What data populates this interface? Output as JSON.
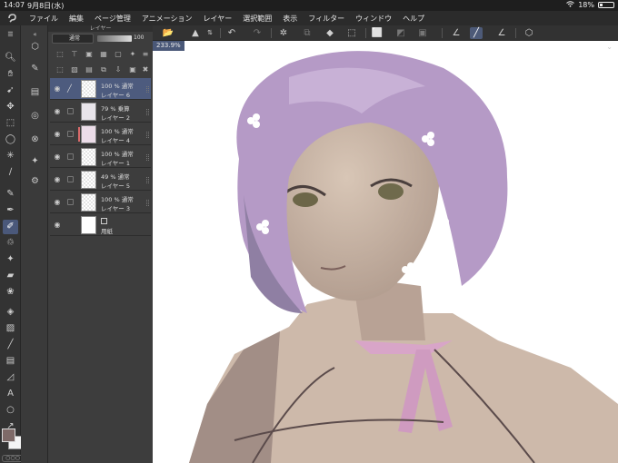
{
  "status_bar": {
    "time": "14:07",
    "date": "9月8日(水)",
    "battery_text": "18%",
    "battery_level": 0.18,
    "wifi_icon": "wifi-icon"
  },
  "menu": {
    "logo": "clip-studio-logo",
    "items": [
      "ファイル",
      "編集",
      "ページ管理",
      "アニメーション",
      "レイヤー",
      "選択範囲",
      "表示",
      "フィルター",
      "ウィンドウ",
      "ヘルプ"
    ]
  },
  "layer_panel": {
    "title": "レイヤー",
    "blend_mode": "通常",
    "opacity": "100",
    "layers": [
      {
        "opacity_mode": "100 % 通常",
        "name": "レイヤー 6",
        "selected": true,
        "pen": true
      },
      {
        "opacity_mode": "79 % 乗算",
        "name": "レイヤー 2"
      },
      {
        "opacity_mode": "100 % 通常",
        "name": "レイヤー 4",
        "clip": true
      },
      {
        "opacity_mode": "100 % 通常",
        "name": "レイヤー 1"
      },
      {
        "opacity_mode": "49 % 通常",
        "name": "レイヤー 5"
      },
      {
        "opacity_mode": "100 % 通常",
        "name": "レイヤー 3"
      },
      {
        "opacity_mode": "",
        "name": "用紙",
        "paper": true
      }
    ]
  },
  "canvas": {
    "zoom": "233.9%"
  },
  "colors": {
    "main": "#7e6a68",
    "sub": "#f5f5f5",
    "accent": "#4d5b7e"
  },
  "tools": [
    "grip-icon",
    "zoom-icon",
    "hand-icon",
    "pen-icon",
    "move-icon",
    "select-icon",
    "lasso-icon",
    "wand-icon",
    "eyedropper-icon",
    "pencil-icon",
    "pen-nib-icon",
    "brush-icon",
    "airbrush-icon",
    "sparkle-icon",
    "eraser-icon",
    "blend-icon",
    "fill-icon",
    "gradient-icon",
    "line-icon",
    "frame-icon",
    "ruler-icon",
    "text-icon",
    "balloon-icon",
    "correct-icon"
  ]
}
